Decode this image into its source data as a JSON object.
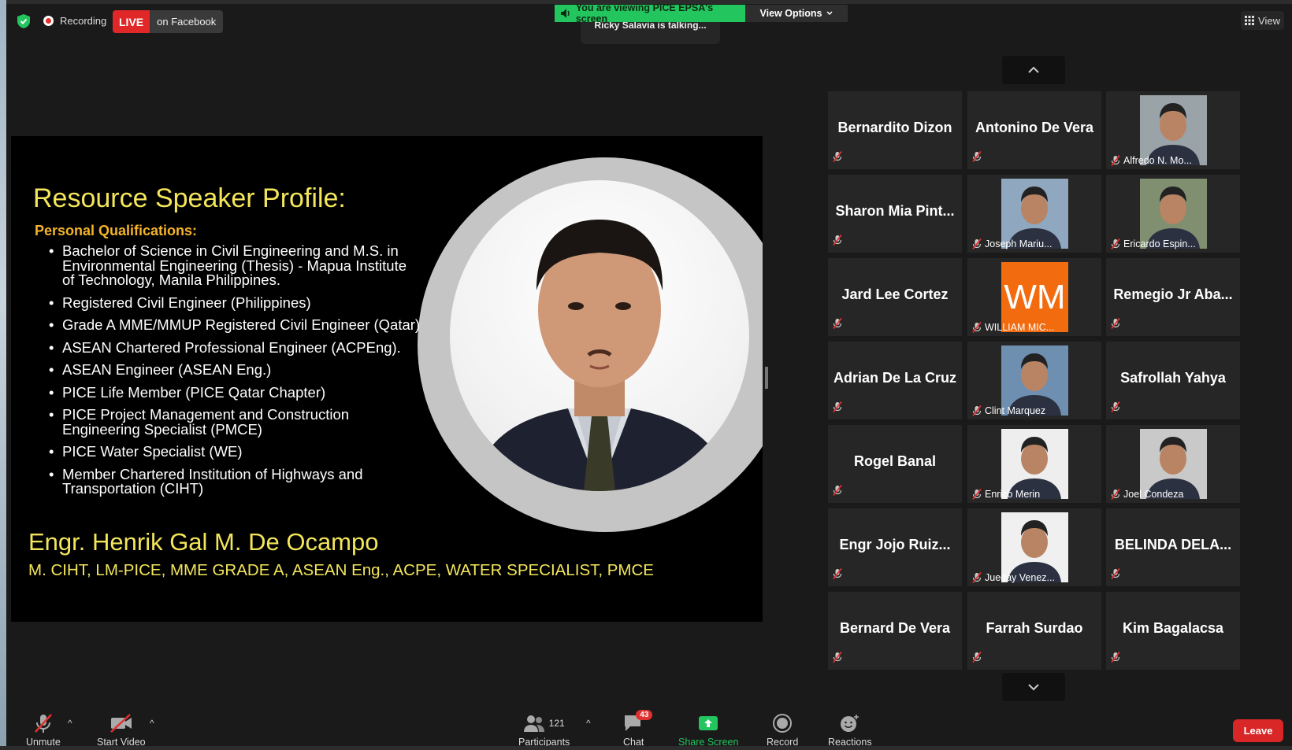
{
  "top": {
    "recording_label": "Recording",
    "live_badge": "LIVE",
    "live_platform": "on Facebook",
    "viewing_banner": "You are viewing PICE EPSA's screen",
    "view_options": "View Options",
    "talking": "Ricky Salavia is talking...",
    "view_button": "View"
  },
  "slide": {
    "title": "Resource Speaker Profile:",
    "subtitle": "Personal Qualifications:",
    "bullets": [
      {
        "lines": [
          "Bachelor of Science in Civil Engineering and M.S. in",
          "Environmental Engineering (Thesis)  - Mapua Institute",
          "of Technology, Manila Philippines."
        ]
      },
      {
        "lines": [
          "Registered Civil Engineer (Philippines)"
        ]
      },
      {
        "lines": [
          "Grade A MME/MMUP Registered Civil Engineer (Qatar)"
        ]
      },
      {
        "lines": [
          "ASEAN Chartered Professional Engineer (ACPEng)."
        ]
      },
      {
        "lines": [
          "ASEAN Engineer (ASEAN Eng.)"
        ]
      },
      {
        "lines": [
          "PICE Life Member (PICE Qatar Chapter)"
        ]
      },
      {
        "lines": [
          "PICE Project Management and Construction",
          "Engineering Specialist (PMCE)"
        ]
      },
      {
        "lines": [
          "PICE Water Specialist (WE)"
        ]
      },
      {
        "lines": [
          "Member Chartered Institution of Highways and",
          "Transportation (CIHT)"
        ]
      }
    ],
    "speaker_name": "Engr. Henrik Gal M. De Ocampo",
    "speaker_credentials": "M. CIHT, LM-PICE, MME GRADE A, ASEAN Eng., ACPE, WATER SPECIALIST, PMCE"
  },
  "gallery": {
    "tiles": [
      {
        "name": "Bernardito Dizon",
        "type": "name"
      },
      {
        "name": "Antonino De Vera",
        "type": "name"
      },
      {
        "name": "Alfredo N. Mo...",
        "type": "video",
        "tone": "#9aa3a8"
      },
      {
        "name": "Sharon  Mia  Pint...",
        "type": "name"
      },
      {
        "name": "Joseph Mariu...",
        "type": "video",
        "tone": "#8fa7bf"
      },
      {
        "name": "Ericardo Espin...",
        "type": "video",
        "tone": "#7f8f6f"
      },
      {
        "name": "Jard Lee Cortez",
        "type": "name"
      },
      {
        "name": "WILLIAM MIC...",
        "type": "initials",
        "initials": "WM",
        "color": "#f26b0f"
      },
      {
        "name": "Remegio  Jr  Aba...",
        "type": "name"
      },
      {
        "name": "Adrian De La Cruz",
        "type": "name"
      },
      {
        "name": "Clint Marquez",
        "type": "video",
        "tone": "#6f8fb0"
      },
      {
        "name": "Safrollah Yahya",
        "type": "name"
      },
      {
        "name": "Rogel Banal",
        "type": "name"
      },
      {
        "name": "Enrico Merin",
        "type": "video",
        "tone": "#eeeeee"
      },
      {
        "name": "Joel Condeza",
        "type": "video",
        "tone": "#c9c9c9"
      },
      {
        "name": "Engr Jojo Ruiz...",
        "type": "name"
      },
      {
        "name": "Jueday Venez...",
        "type": "video",
        "tone": "#f0f0f0"
      },
      {
        "name": "BELINDA  DELA...",
        "type": "name"
      },
      {
        "name": "Bernard De Vera",
        "type": "name"
      },
      {
        "name": "Farrah Surdao",
        "type": "name"
      },
      {
        "name": "Kim Bagalacsa",
        "type": "name"
      }
    ]
  },
  "toolbar": {
    "unmute": "Unmute",
    "start_video": "Start Video",
    "participants": "Participants",
    "participants_count": "121",
    "chat": "Chat",
    "chat_badge": "43",
    "share_screen": "Share Screen",
    "record": "Record",
    "reactions": "Reactions",
    "leave": "Leave"
  },
  "colors": {
    "accent_green": "#22c55e",
    "live_red": "#e02828",
    "slide_yellow": "#f3e65a",
    "slide_orange": "#f5b428",
    "muted_red": "#e0312f"
  }
}
